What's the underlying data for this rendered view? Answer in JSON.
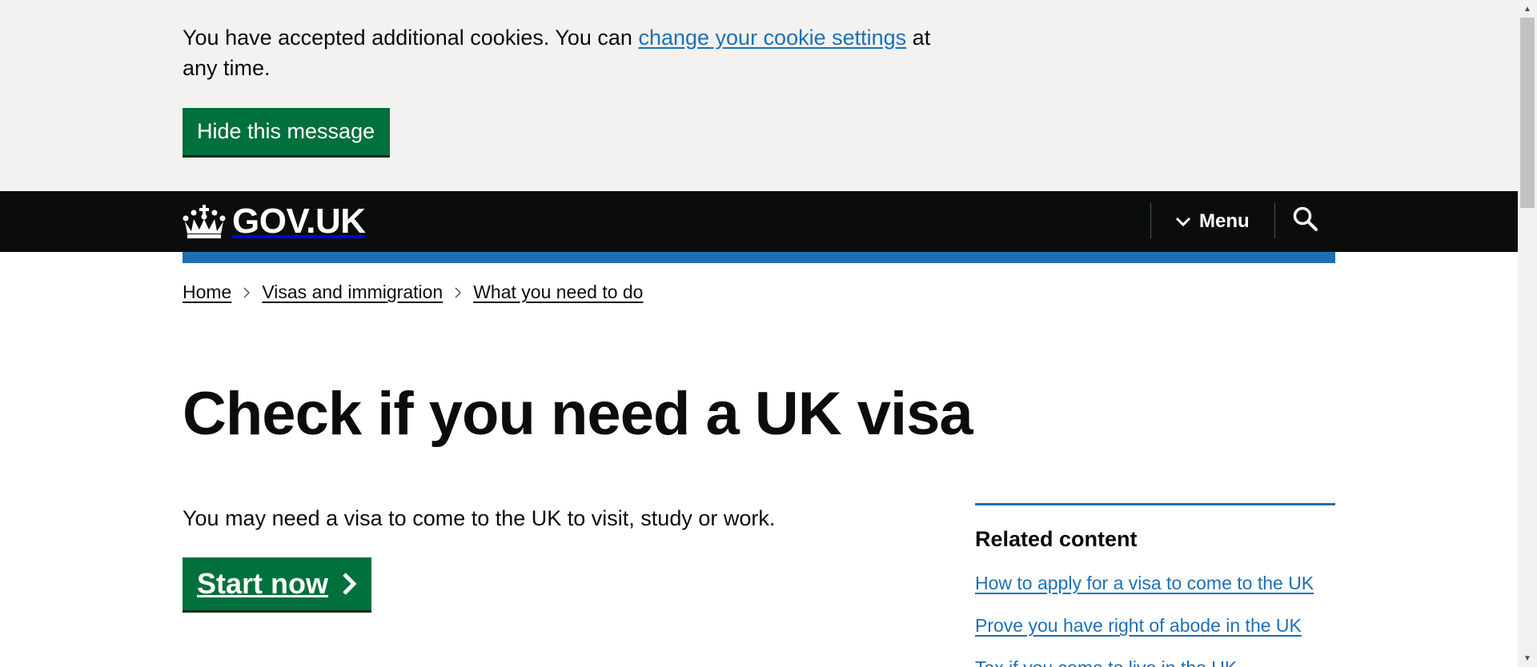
{
  "cookie_banner": {
    "text_before": "You have accepted additional cookies. You can ",
    "link": "change your cookie settings",
    "text_after": " at any time.",
    "hide_button": "Hide this message"
  },
  "header": {
    "logo_text": "GOV.UK",
    "menu_label": "Menu",
    "logo_icon": "crown-icon",
    "menu_icon": "chevron-down-icon",
    "search_icon": "search-icon"
  },
  "breadcrumbs": [
    "Home",
    "Visas and immigration",
    "What you need to do"
  ],
  "main": {
    "title": "Check if you need a UK visa",
    "lead": "You may need a visa to come to the UK to visit, study or work.",
    "start_button": "Start now"
  },
  "related": {
    "heading": "Related content",
    "links": [
      "How to apply for a visa to come to the UK",
      "Prove you have right of abode in the UK",
      "Tax if you come to live in the UK"
    ]
  },
  "colors": {
    "banner_bg": "#f3f2f1",
    "header_bg": "#0b0c0c",
    "brand_blue": "#1d70b8",
    "button_green": "#00703c",
    "text": "#0b0c0c"
  }
}
